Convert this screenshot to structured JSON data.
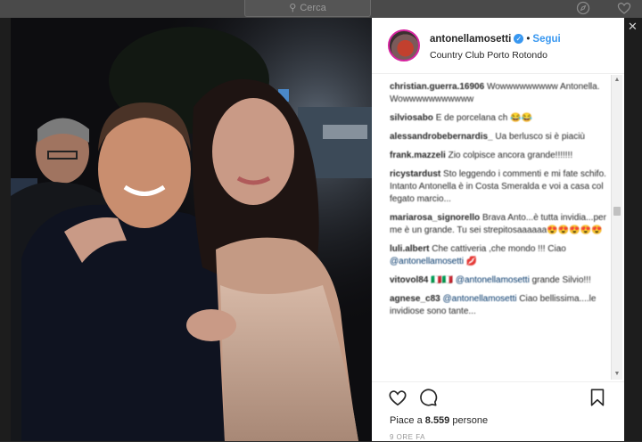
{
  "background": {
    "search_placeholder": "Cerca",
    "search_icon": "search-icon",
    "compass_icon": "compass-icon",
    "heart_icon": "heart-icon",
    "close_icon": "close-icon",
    "overlay_color": "#2b2b2b"
  },
  "post": {
    "username": "antonellamosetti",
    "verified": true,
    "dot": "•",
    "follow_label": "Segui",
    "location": "Country Club Porto Rotondo",
    "accent": "#3897f0"
  },
  "comments": [
    {
      "user": "christian.guerra.16906",
      "text": "Wowwwwwwwww Antonella. Wowwwwwwwwwww"
    },
    {
      "user": "silviosabo",
      "text": "E de porcelana ch 😂😂"
    },
    {
      "user": "alessandrobebernardis_",
      "text": "Ua berlusco si è piaciù"
    },
    {
      "user": "frank.mazzeli",
      "text": "Zio colpisce ancora grande!!!!!!!"
    },
    {
      "user": "ricystardust",
      "text": "Sto leggendo i commenti e mi fate schifo. Intanto Antonella è in Costa Smeralda e voi a casa col fegato marcio..."
    },
    {
      "user": "mariarosa_signorello",
      "text": "Brava Anto...è tutta invidia...per me è un grande. Tu sei strepitosaaaaaa😍😍😍😍😍"
    },
    {
      "user": "luli.albert",
      "text": "Che cattiveria ,che mondo !!! Ciao",
      "mention": "@antonellamosetti",
      "emoji": "💋"
    },
    {
      "user": "vitovol84",
      "text": "🇮🇹🇮🇹",
      "mention": "@antonellamosetti",
      "tail": "grande Silvio!!!"
    },
    {
      "user": "agnese_c83",
      "mention": "@antonellamosetti",
      "text": "Ciao bellissima....le invidiose sono tante..."
    }
  ],
  "actions": {
    "like_icon": "heart-outline-icon",
    "comment_icon": "comment-icon",
    "save_icon": "bookmark-icon"
  },
  "likes": {
    "prefix": "Piace a",
    "count": "8.559",
    "suffix": "persone"
  },
  "timestamp": "9 ORE FA"
}
